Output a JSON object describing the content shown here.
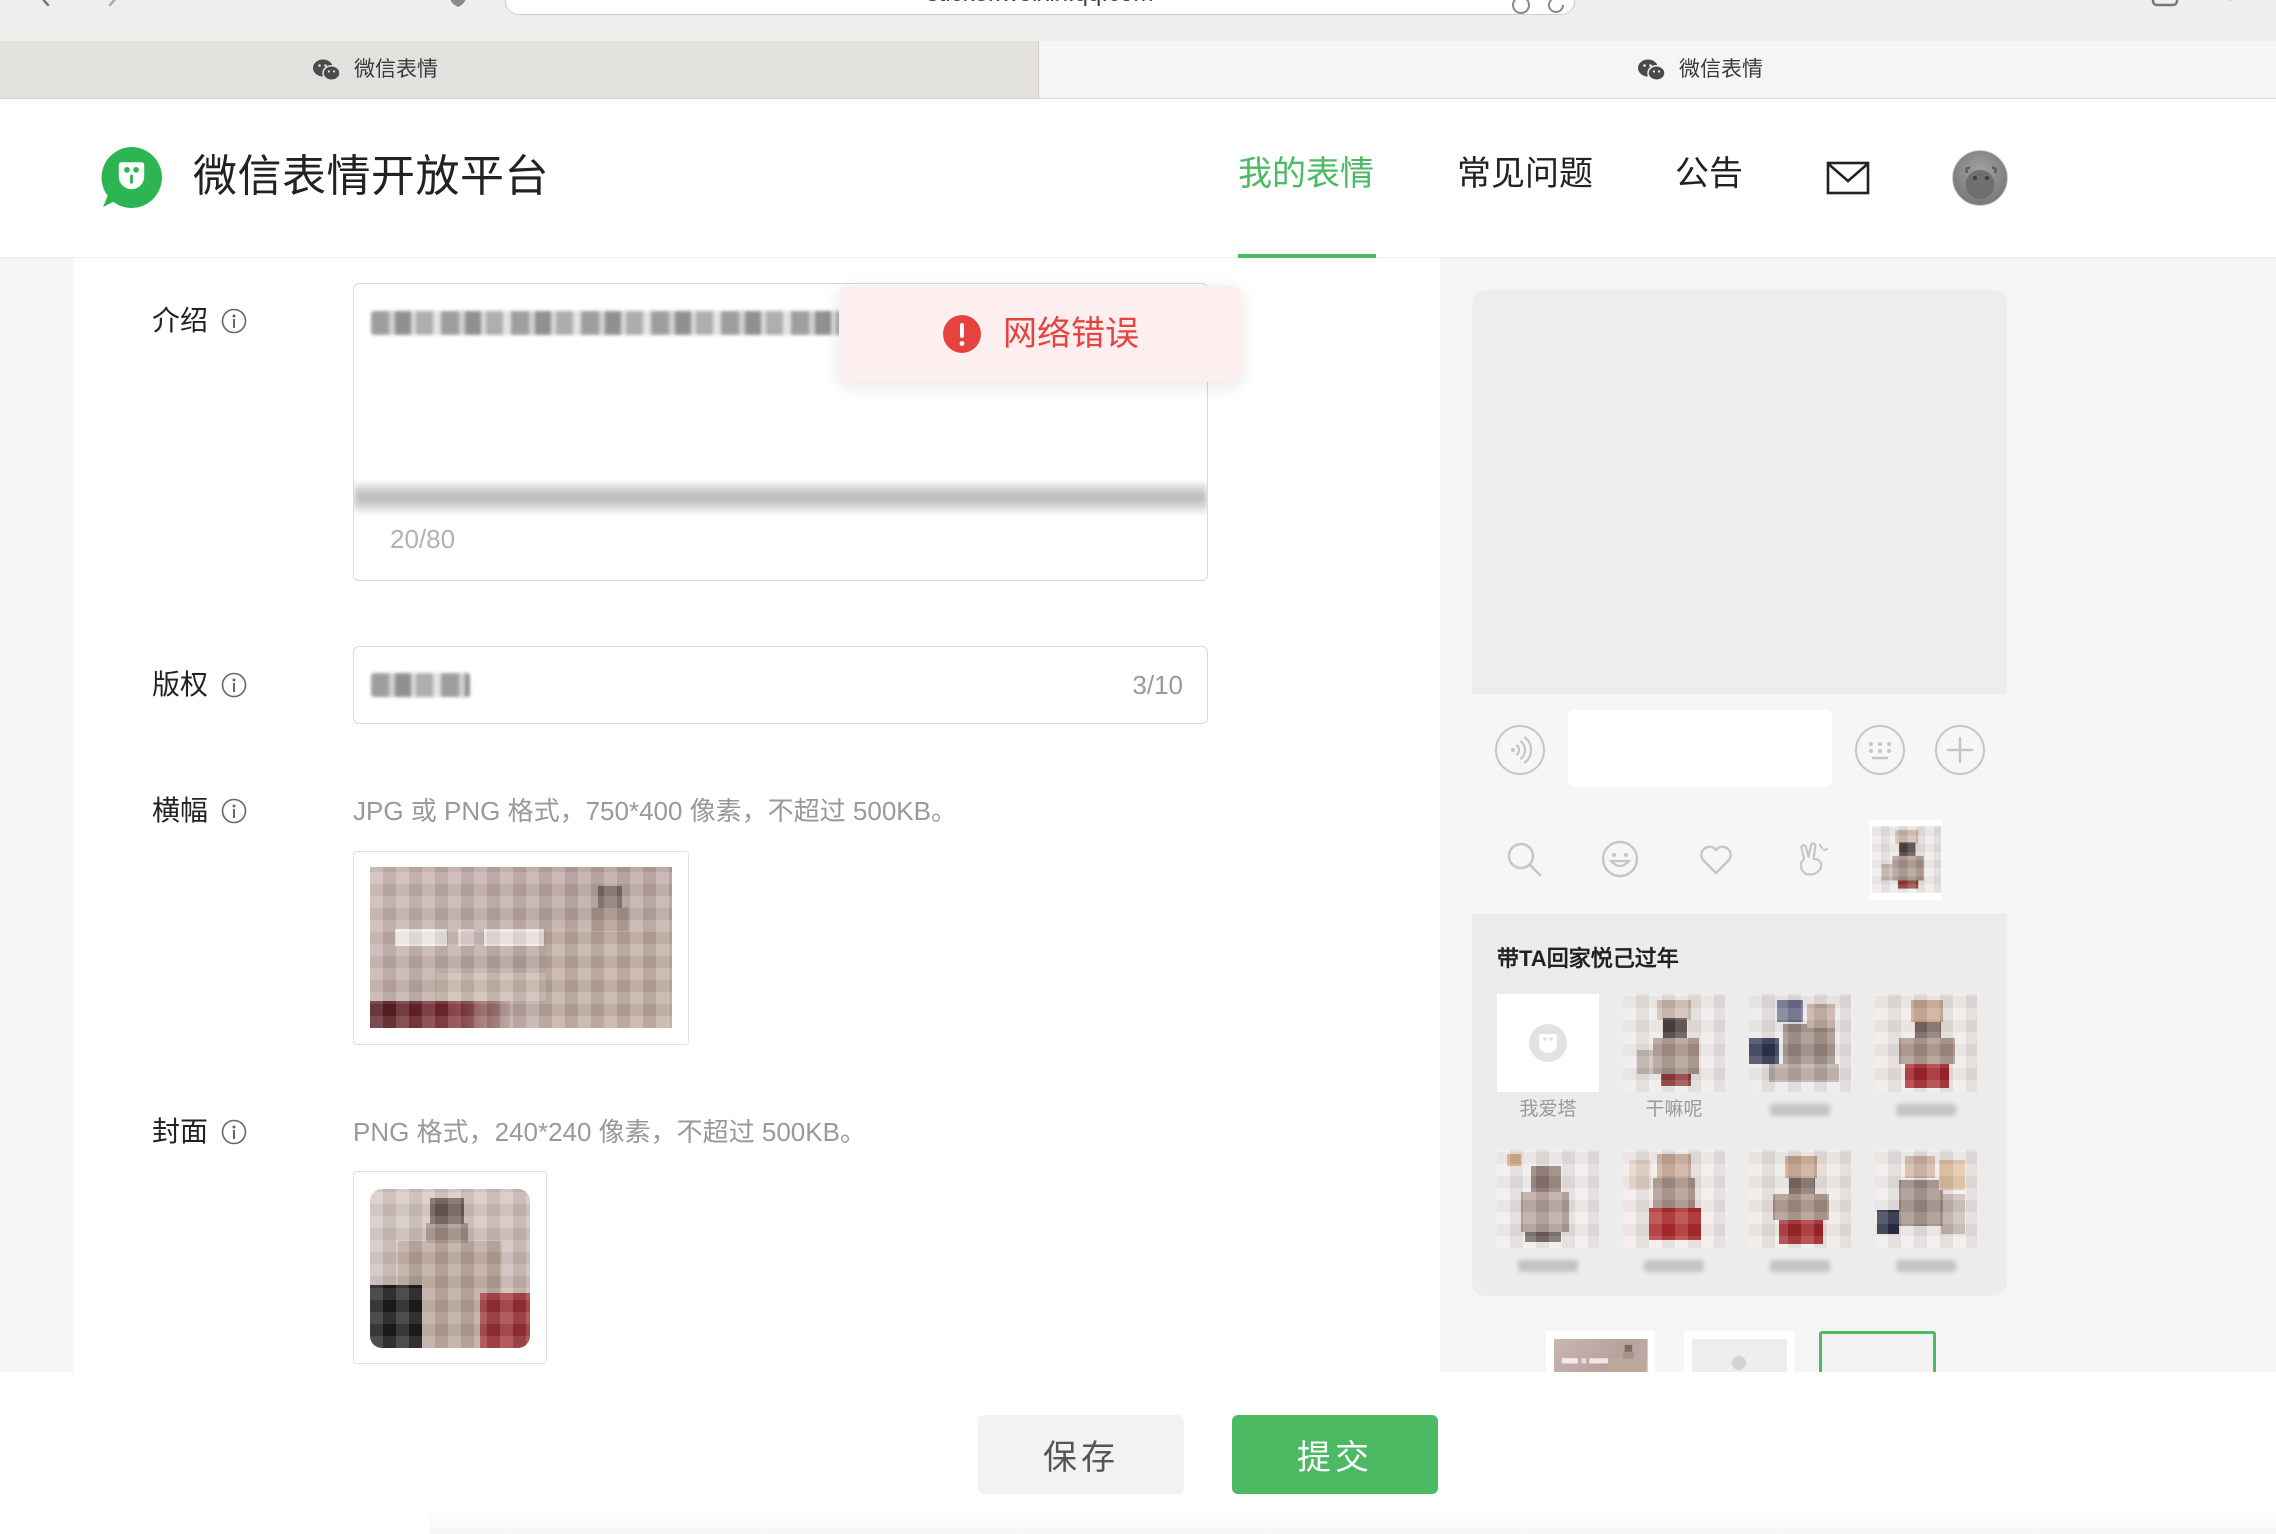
{
  "colors": {
    "brand_green": "#4cb963",
    "logo_green": "#2db553",
    "error_red": "#e64340",
    "toast_bg": "#fdefef",
    "text_primary": "#222222",
    "text_hint": "#999999"
  },
  "browser": {
    "url": "sticker.weixin.qq.com",
    "tabs": [
      {
        "label": "微信表情",
        "icon": "wechat-icon",
        "active": false
      },
      {
        "label": "微信表情",
        "icon": "wechat-icon",
        "active": true
      }
    ]
  },
  "header": {
    "logo_icon": "wechat-sticker-logo-icon",
    "title": "微信表情开放平台",
    "nav": [
      {
        "label": "我的表情",
        "active": true
      },
      {
        "label": "常见问题",
        "active": false
      },
      {
        "label": "公告",
        "active": false
      }
    ],
    "mail_icon": "mail-icon",
    "avatar_icon": "user-avatar-icon"
  },
  "toast": {
    "icon": "error-icon",
    "message": "网络错误"
  },
  "form": {
    "info_icon": "info-icon",
    "intro": {
      "label": "介绍",
      "counter": "20/80"
    },
    "copyright": {
      "label": "版权",
      "counter": "3/10"
    },
    "banner": {
      "label": "横幅",
      "hint": "JPG 或 PNG 格式，750*400 像素，不超过 500KB。"
    },
    "cover": {
      "label": "封面",
      "hint": "PNG 格式，240*240 像素，不超过 500KB。"
    }
  },
  "preview": {
    "input_icons": [
      "voice-icon",
      "emoji-keyboard-icon",
      "plus-icon"
    ],
    "sticker_tabs": [
      "search-icon",
      "smiley-icon",
      "heart-icon",
      "peace-hand-icon"
    ],
    "pack_title": "带TA回家悦己过年",
    "sticker_labels": [
      "我爱塔",
      "干嘛呢"
    ],
    "preview_modes": [
      {
        "selected": false
      },
      {
        "selected": false
      },
      {
        "selected": true
      }
    ]
  },
  "footer": {
    "save_label": "保存",
    "submit_label": "提交"
  }
}
